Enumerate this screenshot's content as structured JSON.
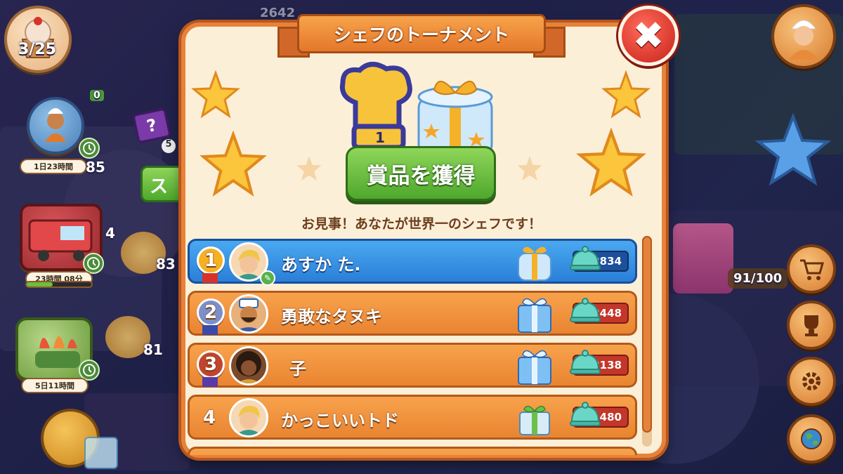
{
  "hud": {
    "level_progress": "3/25",
    "coins": "2642",
    "badge_zero": "0",
    "badge_five": "5",
    "num_85": "85",
    "num_4": "4",
    "num_83": "83",
    "num_81": "81",
    "partial_button_text": "ス",
    "timer_1": "1日23時間",
    "timer_2": "23時間 08分",
    "timer_3": "5日11時間",
    "right_progress": "91/100"
  },
  "modal": {
    "title": "シェフのトーナメント",
    "close_label": "✖",
    "trophy_rank": "1",
    "claim_button": "賞品を獲得",
    "subtitle": "お見事！あなたが世界一のシェフです！"
  },
  "leaderboard": [
    {
      "rank": "1",
      "name": "あすか た.",
      "score": "2834",
      "is_me": true,
      "medal": "gold",
      "gift": "gold-gift"
    },
    {
      "rank": "2",
      "name": "勇敢なタヌキ",
      "score": "2448",
      "is_me": false,
      "medal": "silver",
      "gift": "blue-gift"
    },
    {
      "rank": "3",
      "name": "子",
      "score": "2138",
      "is_me": false,
      "medal": "bronze",
      "gift": "blue-gift"
    },
    {
      "rank": "4",
      "name": "かっこいいトド",
      "score": "1480",
      "is_me": false,
      "medal": "none",
      "gift": "green-gift"
    }
  ],
  "colors": {
    "accent_orange": "#e98431",
    "me_blue": "#2a7fd8",
    "claim_green": "#4ea82c",
    "close_red": "#c8221a"
  }
}
